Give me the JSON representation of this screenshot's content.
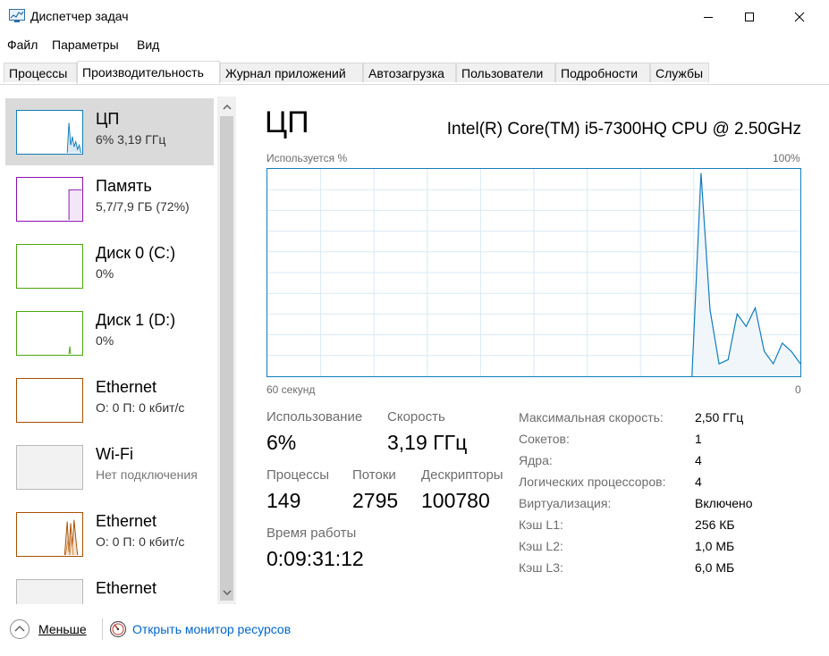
{
  "window": {
    "title": "Диспетчер задач"
  },
  "menu": [
    "Файл",
    "Параметры",
    "Вид"
  ],
  "tabs": [
    {
      "label": "Процессы",
      "active": false
    },
    {
      "label": "Производительность",
      "active": true
    },
    {
      "label": "Журнал приложений",
      "active": false
    },
    {
      "label": "Автозагрузка",
      "active": false
    },
    {
      "label": "Пользователи",
      "active": false
    },
    {
      "label": "Подробности",
      "active": false
    },
    {
      "label": "Службы",
      "active": false
    }
  ],
  "resources": [
    {
      "name": "ЦП",
      "sub": "6% 3,19 ГГц",
      "selected": true,
      "color": "#117dbb"
    },
    {
      "name": "Память",
      "sub": "5,7/7,9 ГБ (72%)",
      "color": "#8b12ae"
    },
    {
      "name": "Диск 0 (C:)",
      "sub": "0%",
      "color": "#4da60c"
    },
    {
      "name": "Диск 1 (D:)",
      "sub": "0%",
      "color": "#4da60c"
    },
    {
      "name": "Ethernet",
      "sub": "О: 0 П: 0 кбит/с",
      "color": "#a74f01"
    },
    {
      "name": "Wi-Fi",
      "sub": "Нет подключения",
      "color": "#b0b0b0"
    },
    {
      "name": "Ethernet",
      "sub": "О: 0 П: 0 кбит/с",
      "color": "#a74f01"
    },
    {
      "name": "Ethernet",
      "sub": "",
      "color": "#b0b0b0"
    }
  ],
  "main": {
    "title": "ЦП",
    "cpu_model": "Intel(R) Core(TM) i5-7300HQ CPU @ 2.50GHz",
    "graph_top_left": "Используется %",
    "graph_top_right": "100%",
    "graph_bottom_left": "60 секунд",
    "graph_bottom_right": "0",
    "cpu_usage_series": [
      0,
      0,
      0,
      0,
      0,
      0,
      0,
      0,
      0,
      0,
      0,
      0,
      0,
      0,
      0,
      0,
      0,
      0,
      0,
      0,
      0,
      0,
      0,
      0,
      0,
      0,
      0,
      0,
      0,
      0,
      0,
      0,
      0,
      0,
      0,
      0,
      0,
      0,
      0,
      0,
      0,
      0,
      0,
      0,
      0,
      0,
      0,
      0,
      98,
      32,
      6,
      8,
      30,
      24,
      33,
      12,
      6,
      16,
      12,
      6
    ],
    "stats": {
      "usage_label": "Использование",
      "usage_value": "6%",
      "speed_label": "Скорость",
      "speed_value": "3,19 ГГц",
      "processes_label": "Процессы",
      "processes_value": "149",
      "threads_label": "Потоки",
      "threads_value": "2795",
      "handles_label": "Дескрипторы",
      "handles_value": "100780",
      "uptime_label": "Время работы",
      "uptime_value": "0:09:31:12"
    },
    "details": [
      {
        "key": "Максимальная скорость:",
        "value": "2,50 ГГц"
      },
      {
        "key": "Сокетов:",
        "value": "1"
      },
      {
        "key": "Ядра:",
        "value": "4"
      },
      {
        "key": "Логических процессоров:",
        "value": "4"
      },
      {
        "key": "Виртуализация:",
        "value": "Включено"
      },
      {
        "key": "Кэш L1:",
        "value": "256 КБ"
      },
      {
        "key": "Кэш L2:",
        "value": "1,0 МБ"
      },
      {
        "key": "Кэш L3:",
        "value": "6,0 МБ"
      }
    ]
  },
  "footer": {
    "less_label": "Меньше",
    "monitor_link": "Открыть монитор ресурсов"
  },
  "colors": {
    "accent": "#117dbb",
    "graph_fill": "#f1f6fa",
    "grid": "#d9eaf4",
    "link": "#0066cc"
  }
}
